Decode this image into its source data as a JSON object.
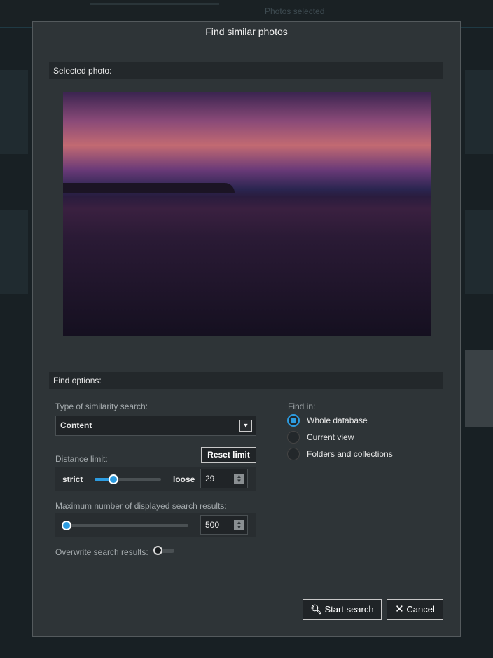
{
  "background": {
    "photos_selected": "Photos selected"
  },
  "dialog": {
    "title": "Find similar photos",
    "selected_photo_header": "Selected photo:",
    "find_options_header": "Find options:",
    "similarity_type_label": "Type of similarity search:",
    "similarity_type_value": "Content",
    "distance_limit_label": "Distance limit:",
    "reset_limit_label": "Reset limit",
    "strict_label": "strict",
    "loose_label": "loose",
    "distance_value": "29",
    "distance_slider_percent": 28,
    "max_results_label": "Maximum number of displayed search results:",
    "max_results_value": "500",
    "max_results_slider_percent": 0,
    "overwrite_label": "Overwrite search results:",
    "overwrite_on": false,
    "find_in_label": "Find in:",
    "find_in_options": [
      {
        "label": "Whole database",
        "selected": true
      },
      {
        "label": "Current view",
        "selected": false
      },
      {
        "label": "Folders and collections",
        "selected": false
      }
    ],
    "start_search_label": "Start search",
    "cancel_label": "Cancel"
  },
  "colors": {
    "accent": "#2d9ce0",
    "dialog_bg": "#2e3437"
  }
}
